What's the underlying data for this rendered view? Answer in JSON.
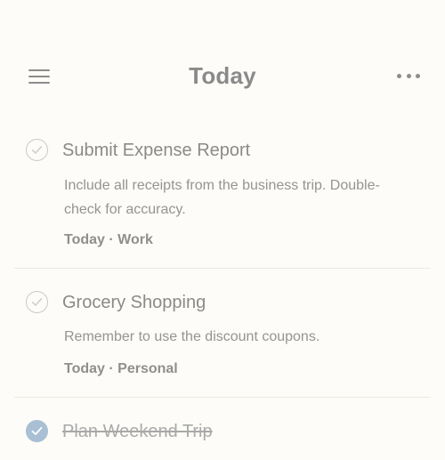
{
  "header": {
    "title": "Today"
  },
  "tasks": [
    {
      "title": "Submit Expense Report",
      "description": "Include all receipts from the business trip. Double-check for accuracy.",
      "meta": "Today · Work",
      "completed": false
    },
    {
      "title": "Grocery Shopping",
      "description": "Remember to use the discount coupons.",
      "meta": "Today · Personal",
      "completed": false
    },
    {
      "title": "Plan Weekend Trip",
      "completed": true
    }
  ],
  "icons": {
    "menu": "hamburger-icon",
    "more": "more-dots-icon",
    "check": "checkmark-icon"
  },
  "colors": {
    "background": "#fdfcf8",
    "completed_check": "#a8bfd4",
    "divider": "#ebe9e2"
  }
}
